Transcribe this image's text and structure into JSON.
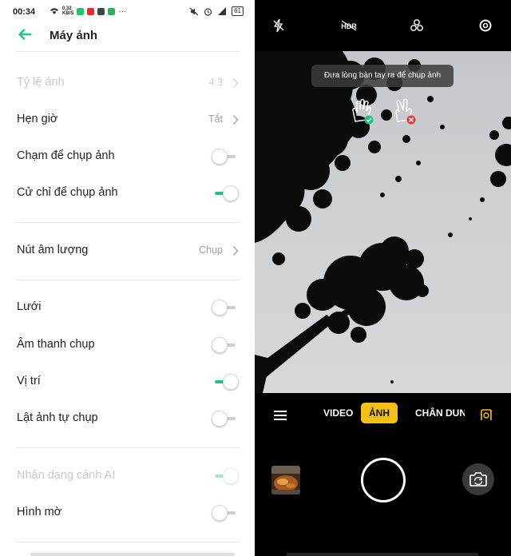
{
  "status_bar": {
    "time": "00:34",
    "speed": "0,32\nKB/S",
    "dots": "···",
    "battery": "61"
  },
  "app_bar": {
    "title": "Máy ảnh"
  },
  "settings": [
    {
      "label": "Tỷ lệ ảnh",
      "value": "4:3",
      "control": "chevron",
      "disabled": true
    },
    {
      "label": "Hẹn giờ",
      "value": "Tắt",
      "control": "chevron"
    },
    {
      "label": "Chạm để chụp ảnh",
      "control": "toggle",
      "on": false
    },
    {
      "label": "Cử chỉ để chụp ảnh",
      "control": "toggle",
      "on": true
    },
    {
      "label": "Nút âm lượng",
      "value": "Chụp",
      "control": "chevron"
    },
    {
      "label": "Lưới",
      "control": "toggle",
      "on": false
    },
    {
      "label": "Âm thanh chụp",
      "control": "toggle",
      "on": false
    },
    {
      "label": "Vị trí",
      "control": "toggle",
      "on": true
    },
    {
      "label": "Lật ảnh tự chụp",
      "control": "toggle",
      "on": false
    },
    {
      "label": "Nhận dạng cảnh AI",
      "control": "toggle",
      "on": true,
      "disabled": true
    },
    {
      "label": "Hình mờ",
      "control": "toggle",
      "on": false
    }
  ],
  "camera": {
    "tooltip": "Đưa lòng bàn tay ra để chụp ảnh",
    "hdr_label": "HDR",
    "modes": [
      "VIDEO",
      "ẢNH",
      "CHÂN DUNG"
    ],
    "active_mode": "ẢNH"
  },
  "colors": {
    "accent_green": "#1ec57a",
    "mode_yellow": "#f5c016",
    "background_dark": "#000000"
  }
}
